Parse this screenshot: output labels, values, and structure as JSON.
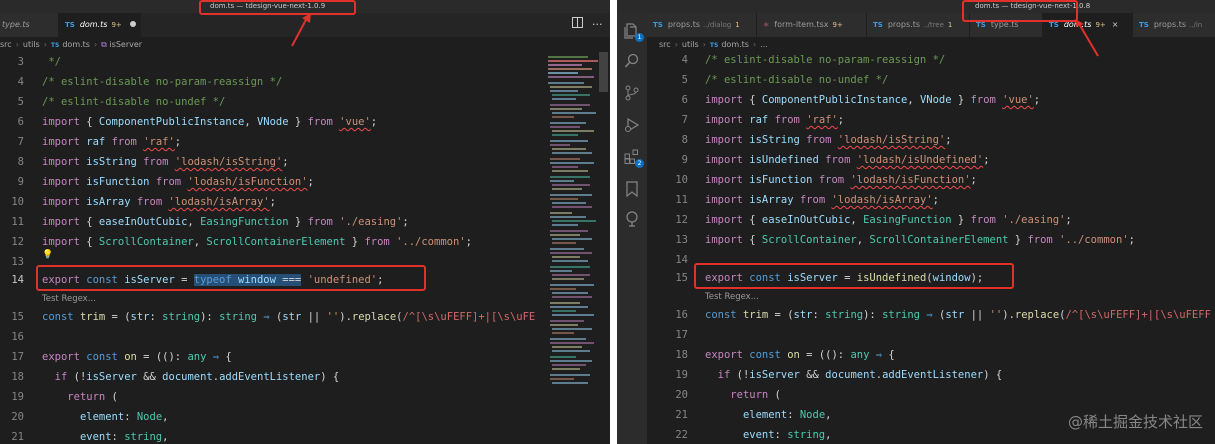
{
  "left": {
    "window_title": "dom.ts — tdesign-vue-next-1.0.9",
    "tabs": [
      {
        "name": "type.ts",
        "icon": "TS",
        "modified": "",
        "sub": ""
      },
      {
        "name": "dom.ts",
        "icon": "TS",
        "modified": "9+",
        "sub": ""
      }
    ],
    "breadcrumb": [
      "src",
      "utils",
      "dom.ts",
      "isServer"
    ],
    "lens_label": "Test Regex...",
    "line_numbers": [
      "3",
      "4",
      "5",
      "6",
      "7",
      "8",
      "9",
      "10",
      "11",
      "12",
      "13",
      "14",
      "15",
      "16",
      "17",
      "18",
      "19",
      "20",
      "21"
    ]
  },
  "right": {
    "window_title": "dom.ts — tdesign-vue-next-1.0.8",
    "tabs": [
      {
        "name": "props.ts",
        "sub": "../dialog",
        "modified": "1"
      },
      {
        "name": "form-item.tsx",
        "sub": "",
        "modified": "9+"
      },
      {
        "name": "props.ts",
        "sub": "../tree",
        "modified": "1"
      },
      {
        "name": "type.ts",
        "sub": "",
        "modified": ""
      },
      {
        "name": "dom.ts",
        "sub": "",
        "modified": "9+"
      },
      {
        "name": "props.ts",
        "sub": "../in",
        "modified": ""
      }
    ],
    "breadcrumb": [
      "src",
      "utils",
      "dom.ts",
      "..."
    ],
    "lens_label": "Test Regex...",
    "line_numbers": [
      "4",
      "5",
      "6",
      "7",
      "8",
      "9",
      "10",
      "11",
      "12",
      "13",
      "14",
      "15",
      "16",
      "17",
      "18",
      "19",
      "20",
      "21",
      "22"
    ],
    "activity_badges": [
      "1",
      "2"
    ]
  },
  "activity_icons": [
    "explorer-icon",
    "search-icon",
    "source-control-icon",
    "run-debug-icon",
    "extensions-icon",
    "bookmarks-icon",
    "tree-icon"
  ],
  "watermark": "@稀土掘金技术社区",
  "colors": {
    "highlight_box": "#e0312a",
    "selection": "#264f78"
  }
}
